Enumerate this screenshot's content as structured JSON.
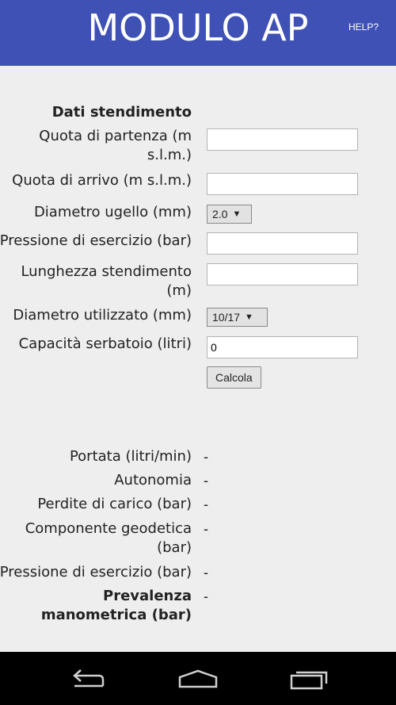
{
  "header": {
    "title": "MODULO AP",
    "help_label": "HELP?"
  },
  "form": {
    "section_title": "Dati stendimento",
    "quota_partenza": {
      "label": "Quota di partenza (m s.l.m.)",
      "value": ""
    },
    "quota_arrivo": {
      "label": "Quota di arrivo (m s.l.m.)",
      "value": ""
    },
    "diametro_ugello": {
      "label": "Diametro ugello (mm)",
      "value": "2.0"
    },
    "pressione": {
      "label": "Pressione di esercizio (bar)",
      "value": ""
    },
    "lunghezza": {
      "label": "Lunghezza stendimento (m)",
      "value": ""
    },
    "diametro_utilizzato": {
      "label": "Diametro utilizzato (mm)",
      "value": "10/17"
    },
    "capacita": {
      "label": "Capacità serbatoio (litri)",
      "value": "0"
    },
    "calcola_label": "Calcola"
  },
  "results": {
    "portata": {
      "label": "Portata (litri/min)",
      "value": "-"
    },
    "autonomia": {
      "label": "Autonomia",
      "value": "-"
    },
    "perdite": {
      "label": "Perdite di carico (bar)",
      "value": "-"
    },
    "componente": {
      "label": "Componente geodetica (bar)",
      "value": "-"
    },
    "pressione": {
      "label": "Pressione di esercizio (bar)",
      "value": "-"
    },
    "prevalenza": {
      "label": "Prevalenza manometrica (bar)",
      "value": "-"
    }
  },
  "navbar": {
    "icons": [
      "back-icon",
      "home-icon",
      "recents-icon"
    ]
  }
}
